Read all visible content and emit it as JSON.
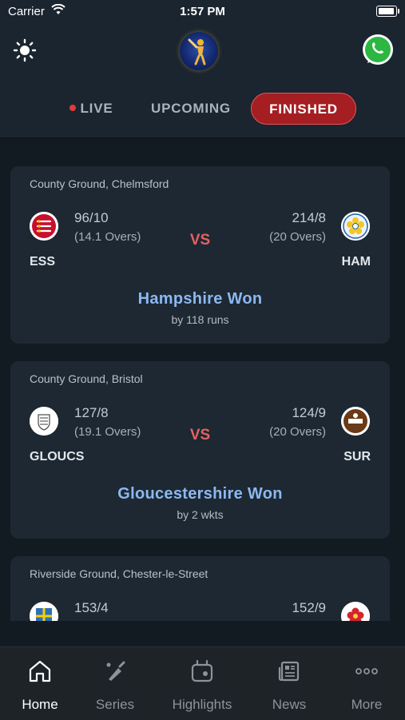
{
  "status_bar": {
    "carrier": "Carrier",
    "time": "1:57 PM",
    "battery_level": 0.95
  },
  "header": {
    "icons": [
      "sun-icon",
      "app-logo",
      "whatsapp-icon"
    ]
  },
  "tabs": [
    {
      "label": "LIVE",
      "active": false
    },
    {
      "label": "UPCOMING",
      "active": false
    },
    {
      "label": "FINISHED",
      "active": true
    }
  ],
  "matches": [
    {
      "venue": "County Ground, Chelmsford",
      "team1": {
        "abbr": "ESS",
        "score": "96/10",
        "overs": "(14.1 Overs)"
      },
      "team2": {
        "abbr": "HAM",
        "score": "214/8",
        "overs": "(20 Overs)"
      },
      "vs": "VS",
      "result": "Hampshire Won",
      "margin": "by 118 runs"
    },
    {
      "venue": "County Ground, Bristol",
      "team1": {
        "abbr": "GLOUCS",
        "score": "127/8",
        "overs": "(19.1 Overs)"
      },
      "team2": {
        "abbr": "SUR",
        "score": "124/9",
        "overs": "(20 Overs)"
      },
      "vs": "VS",
      "result": "Gloucestershire Won",
      "margin": "by 2 wkts"
    },
    {
      "venue": "Riverside Ground, Chester-le-Street",
      "team1": {
        "abbr": "",
        "score": "153/4",
        "overs": ""
      },
      "team2": {
        "abbr": "",
        "score": "152/9",
        "overs": ""
      },
      "vs": "",
      "result": "",
      "margin": ""
    }
  ],
  "tabbar": [
    {
      "label": "Home",
      "icon": "home-icon",
      "active": true
    },
    {
      "label": "Series",
      "icon": "cricket-bat-icon",
      "active": false
    },
    {
      "label": "Highlights",
      "icon": "highlights-icon",
      "active": false
    },
    {
      "label": "News",
      "icon": "news-icon",
      "active": false
    },
    {
      "label": "More",
      "icon": "more-icon",
      "active": false
    }
  ],
  "colors": {
    "accent_red": "#a51e22",
    "result_blue": "#8cb8f0",
    "vs_red": "#e4625e",
    "live_dot": "#e23a3a"
  }
}
